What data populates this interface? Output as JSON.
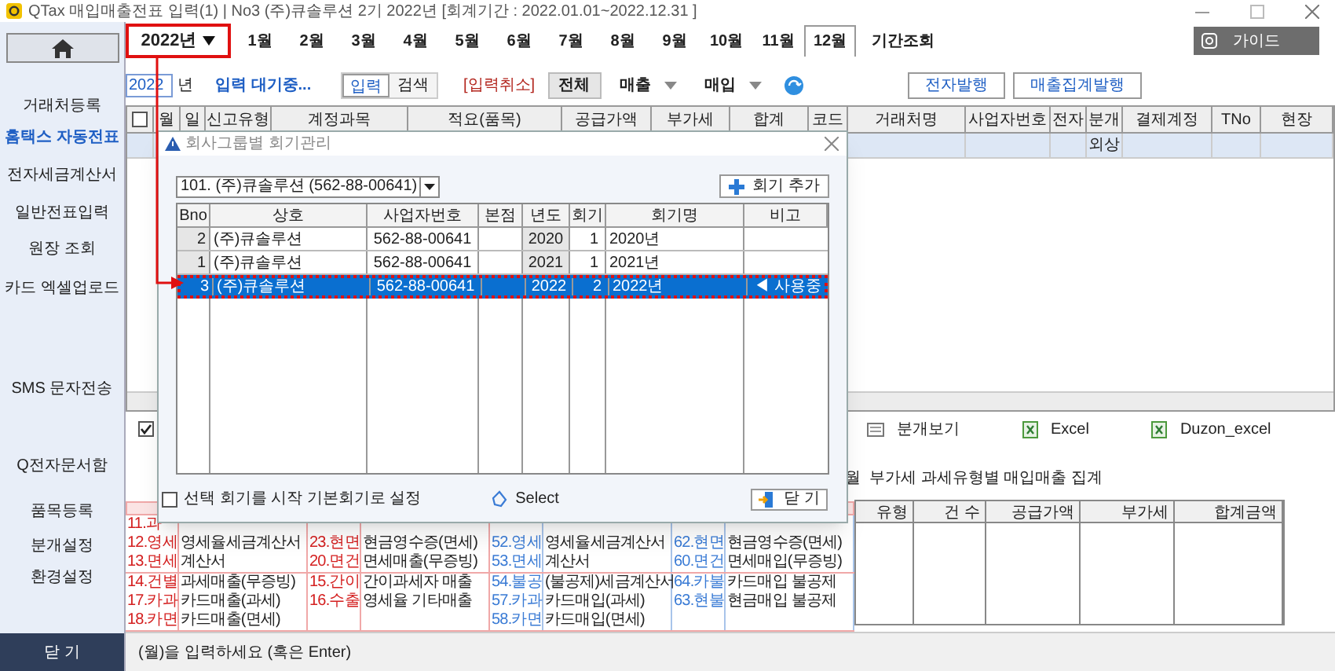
{
  "window": {
    "title": "QTax 매입매출전표 입력(1)  | No3 (주)큐솔루션 2기 2022년 [회계기간 : 2022.01.01~2022.12.31 ]"
  },
  "sidebar": {
    "items": [
      {
        "label": "거래처등록",
        "selected": false
      },
      {
        "label": "홈택스 자동전표",
        "selected": true
      },
      {
        "label": "전자세금계산서",
        "selected": false
      },
      {
        "label": "일반전표입력",
        "selected": false
      },
      {
        "label": "원장 조회",
        "selected": false
      },
      {
        "label": "카드 엑셀업로드",
        "selected": false
      },
      {
        "label": "SMS 문자전송",
        "selected": false
      },
      {
        "label": "Q전자문서함",
        "selected": false
      },
      {
        "label": "품목등록",
        "selected": false
      },
      {
        "label": "분개설정",
        "selected": false
      },
      {
        "label": "환경설정",
        "selected": false
      }
    ],
    "close_button": "닫 기"
  },
  "period": {
    "year": "2022년",
    "tabs": [
      {
        "label": "1월",
        "selected": false
      },
      {
        "label": "2월",
        "selected": false
      },
      {
        "label": "3월",
        "selected": false
      },
      {
        "label": "4월",
        "selected": false
      },
      {
        "label": "5월",
        "selected": false
      },
      {
        "label": "6월",
        "selected": false
      },
      {
        "label": "7월",
        "selected": false
      },
      {
        "label": "8월",
        "selected": false
      },
      {
        "label": "9월",
        "selected": false
      },
      {
        "label": "10월",
        "selected": false
      },
      {
        "label": "11월",
        "selected": false
      },
      {
        "label": "12월",
        "selected": true
      },
      {
        "label": "기간조회",
        "selected": false
      }
    ]
  },
  "guide_button": "가이드",
  "toolbar": {
    "year_field": "2022",
    "year_suffix": "년",
    "status": "입력 대기중...",
    "mode_tabs": [
      {
        "label": "입력",
        "selected": true
      },
      {
        "label": "검색",
        "selected": false
      }
    ],
    "cancel": "[입력취소]",
    "filters": [
      {
        "label": "전체",
        "selected": true,
        "dropdown": false
      },
      {
        "label": "매출",
        "selected": false,
        "dropdown": true
      },
      {
        "label": "매입",
        "selected": false,
        "dropdown": true
      }
    ],
    "buttons": [
      "전자발행",
      "매출집계발행"
    ]
  },
  "entry_table": {
    "header_checkbox": {
      "checked": false
    },
    "columns": [
      "월",
      "일",
      "신고유형",
      "계정과목",
      "적요(품목)",
      "공급가액",
      "부가세",
      "합계",
      "코드",
      "거래처명",
      "사업자번호",
      "전자",
      "분개",
      "결제계정",
      "TNo",
      "현장"
    ],
    "rows": [
      {
        "selected": true,
        "cells": [
          null,
          null,
          null,
          null,
          null,
          null,
          null,
          null,
          null,
          null,
          null,
          null,
          "외상",
          null,
          null,
          null
        ]
      }
    ]
  },
  "view_options": {
    "checkbox": {
      "checked": true
    },
    "items": [
      {
        "kind": "layout",
        "label": "분개보기"
      },
      {
        "kind": "excel",
        "label": "Excel"
      },
      {
        "kind": "excel",
        "label": "Duzon_excel"
      }
    ]
  },
  "summary": {
    "title": "월  부가세 과세유형별 매입매출 집계",
    "columns": [
      "유형",
      "건 수",
      "공급가액",
      "부가세",
      "합계금액"
    ]
  },
  "legend": {
    "groups": [
      {
        "rows": [
          [
            "11.과",
            null,
            null,
            null,
            null,
            null,
            null,
            null
          ],
          [
            "12.영세",
            "영세율세금계산서",
            "23.현면",
            "현금영수증(면세)",
            "52.영세",
            "영세율세금계산서",
            "62.현면",
            "현금영수증(면세)"
          ],
          [
            "13.면세",
            "계산서",
            "20.면건",
            "면세매출(무증빙)",
            "53.면세",
            "계산서",
            "60.면건",
            "면세매입(무증빙)"
          ]
        ]
      },
      {
        "rows": [
          [
            "14.건별",
            "과세매출(무증빙)",
            "15.간이",
            "간이과세자 매출",
            "54.불공",
            "(불공제)세금계산서",
            "64.카불",
            "카드매입 불공제"
          ],
          [
            "17.카과",
            "카드매출(과세)",
            "16.수출",
            "영세율 기타매출",
            "57.카과",
            "카드매입(과세)",
            "63.현불",
            "현금매입 불공제"
          ],
          [
            "18.카면",
            "카드매출(면세)",
            null,
            null,
            "58.카면",
            "카드매입(면세)",
            null,
            null
          ]
        ]
      }
    ]
  },
  "status_bar": "(월)을 입력하세요 (혹은 Enter)",
  "dialog": {
    "title": "회사그룹별 회기관리",
    "company_select": "101. (주)큐솔루션 (562-88-00641)",
    "add_button": "회기 추가",
    "columns": [
      "Bno",
      "상호",
      "사업자번호",
      "본점",
      "년도",
      "회기",
      "회기명",
      "비고"
    ],
    "rows": [
      {
        "bno": "2",
        "name": "(주)큐솔루션",
        "biz_no": "562-88-00641",
        "year": "2020",
        "term": "1",
        "term_name": "2020년",
        "selected": false
      },
      {
        "bno": "1",
        "name": "(주)큐솔루션",
        "biz_no": "562-88-00641",
        "year": "2021",
        "term": "1",
        "term_name": "2021년",
        "selected": false
      },
      {
        "bno": "3",
        "name": "(주)큐솔루션",
        "biz_no": "562-88-00641",
        "year": "2022",
        "term": "2",
        "term_name": "2022년",
        "note": "◀ 사용중",
        "selected": true
      }
    ],
    "default_checkbox": {
      "checked": false,
      "label": "선택 회기를 시작 기본회기로 설정"
    },
    "select_button": "Select",
    "close_button": "닫 기"
  }
}
